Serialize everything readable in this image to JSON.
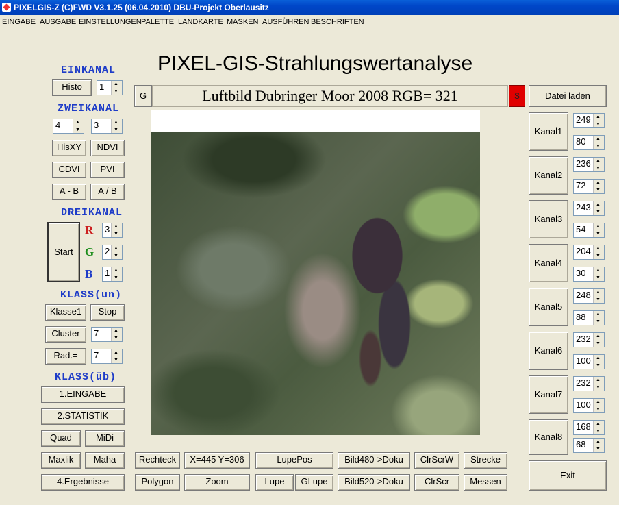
{
  "window": {
    "title": "PIXELGIS-Z (C)FWD V3.1.25 (06.04.2010)  DBU-Projekt Oberlausitz"
  },
  "menu": [
    "EINGABE",
    "AUSGABE",
    "EINSTELLUNGEN",
    "PALETTE",
    "LANDKARTE",
    "MASKEN",
    "AUSFÜHREN",
    "BESCHRIFTEN"
  ],
  "main_title": "PIXEL-GIS-Strahlungswertanalyse",
  "image_bar": {
    "g_button": "G",
    "title": "Luftbild Dubringer Moor 2008 RGB= 321",
    "s_button": "S"
  },
  "left": {
    "einkanal": "EINKANAL",
    "histo": "Histo",
    "histo_value": "1",
    "zweikanal": "ZWEIKANAL",
    "zk_a": "4",
    "zk_b": "3",
    "hisxy": "HisXY",
    "ndvi": "NDVI",
    "cdvi": "CDVI",
    "pvi": "PVI",
    "a_minus_b": "A - B",
    "a_div_b": "A / B",
    "dreikanal": "DREIKANAL",
    "start": "Start",
    "r_label": "R",
    "g_label": "G",
    "b_label": "B",
    "r_value": "3",
    "g_value": "2",
    "b_value": "1",
    "klass_un": "KLASS(un)",
    "klasse1": "Klasse1",
    "stop": "Stop",
    "cluster": "Cluster",
    "cluster_value": "7",
    "rad": "Rad.=",
    "rad_value": "7",
    "klass_ub": "KLASS(üb)",
    "eingabe": "1.EINGABE",
    "statistik": "2.STATISTIK",
    "quad": "Quad",
    "midi": "MiDi",
    "maxlik": "Maxlik",
    "maha": "Maha",
    "ergebnisse": "4.Ergebnisse"
  },
  "bottom": {
    "rechteck": "Rechteck",
    "coords": "X=445 Y=306",
    "lupepos": "LupePos",
    "bild480": "Bild480->Doku",
    "clrscrw": "ClrScrW",
    "strecke": "Strecke",
    "polygon": "Polygon",
    "zoom": "Zoom",
    "lupe": "Lupe",
    "glupe": "GLupe",
    "bild520": "Bild520->Doku",
    "clrscr": "ClrScr",
    "messen": "Messen"
  },
  "right": {
    "datei_laden": "Datei laden",
    "exit": "Exit",
    "channels": [
      {
        "label": "Kanal1",
        "v1": "249",
        "v2": "80"
      },
      {
        "label": "Kanal2",
        "v1": "236",
        "v2": "72"
      },
      {
        "label": "Kanal3",
        "v1": "243",
        "v2": "54"
      },
      {
        "label": "Kanal4",
        "v1": "204",
        "v2": "30"
      },
      {
        "label": "Kanal5",
        "v1": "248",
        "v2": "88"
      },
      {
        "label": "Kanal6",
        "v1": "232",
        "v2": "100"
      },
      {
        "label": "Kanal7",
        "v1": "232",
        "v2": "100"
      },
      {
        "label": "Kanal8",
        "v1": "168",
        "v2": "68"
      }
    ]
  },
  "colors": {
    "title_bar": "#0054e3",
    "header_blue": "#1e3cc8",
    "r": "#cc2020",
    "g": "#1a8c1a",
    "b": "#1e3cc8",
    "s_button": "#e00000"
  }
}
